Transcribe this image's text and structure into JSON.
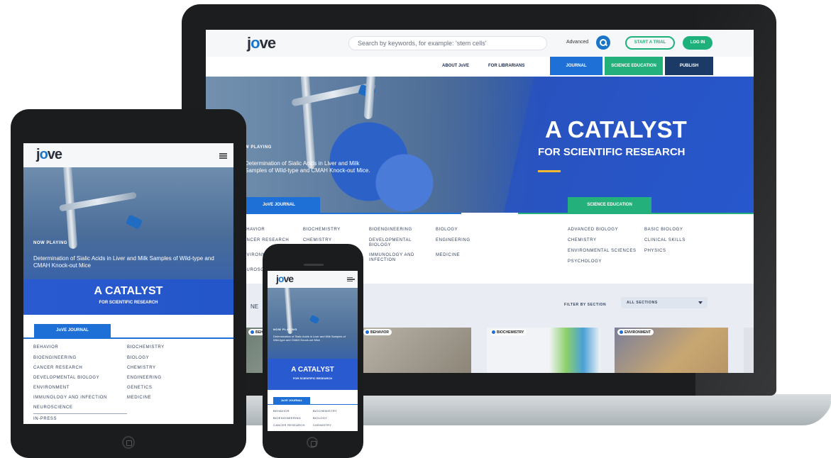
{
  "brand": {
    "logo_prefix": "j",
    "logo_o": "o",
    "logo_suffix": "ve",
    "primary_color": "#1e70d6",
    "green_color": "#23b07a",
    "navy_color": "#1b2a4a"
  },
  "laptop": {
    "search_placeholder": "Search by keywords, for example: 'stem cells'",
    "advanced_label": "Advanced",
    "start_trial_label": "START A TRIAL",
    "login_label": "LOG IN",
    "nav_links": [
      "ABOUT JoVE",
      "FOR LIBRARIANS"
    ],
    "nav_tabs": [
      "JOURNAL",
      "SCIENCE EDUCATION",
      "PUBLISH"
    ],
    "now_playing": "W PLAYING",
    "now_playing_title": "Determination of Sialic Acids in Liver and Milk Samples of Wild-type and CMAH Knock-out Mice.",
    "catalyst_title": "A CATALYST",
    "catalyst_subtitle": "FOR SCIENTIFIC RESEARCH",
    "tab_journal": "JoVE JOURNAL",
    "tab_science_education": "SCIENCE EDUCATION",
    "journal_categories": [
      "BEHAVIOR",
      "BIOCHEMISTRY",
      "BIOENGINEERING",
      "BIOLOGY",
      "CANCER RESEARCH",
      "CHEMISTRY",
      "DEVELOPMENTAL BIOLOGY",
      "ENGINEERING",
      "ENVIRONMENT",
      "IMMUNOLOGY AND INFECTION",
      "MEDICINE",
      "NEUROSCIENCE"
    ],
    "education_categories": [
      "ADVANCED BIOLOGY",
      "BASIC BIOLOGY",
      "CHEMISTRY",
      "CLINICAL SKILLS",
      "ENVIRONMENTAL SCIENCES",
      "PHYSICS",
      "PSYCHOLOGY"
    ],
    "new_label": "NE",
    "filter_label": "FILTER BY SECTION",
    "filter_value": "ALL SECTIONS",
    "cards": [
      "BEHAVIOR",
      "BEHAVIOR",
      "BIOCHEMISTRY",
      "ENVIRONMENT"
    ]
  },
  "tablet": {
    "now_playing": "NOW PLAYING",
    "now_playing_title": "Determination of Sialic Acids in Liver and Milk Samples of Wild-type and CMAH Knock-out Mice",
    "catalyst_title": "A CATALYST",
    "catalyst_subtitle": "FOR SCIENTIFIC RESEARCH",
    "tab_journal": "JoVE JOURNAL",
    "left_categories": [
      "BEHAVIOR",
      "BIOENGINEERING",
      "CANCER RESEARCH",
      "DEVELOPMENTAL BIOLOGY",
      "ENVIRONMENT",
      "IMMUNOLOGY AND INFECTION",
      "NEUROSCIENCE",
      "IN-PRESS"
    ],
    "right_categories": [
      "BIOCHEMISTRY",
      "BIOLOGY",
      "CHEMISTRY",
      "ENGINEERING",
      "GENETICS",
      "MEDICINE"
    ]
  },
  "phone": {
    "now_playing": "NOW PLAYING",
    "now_playing_title": "Determination of Sialic Acids in Liver and Milk Samples of Wild-type and CMAH Knock-out Mice",
    "catalyst_title": "A CATALYST",
    "catalyst_subtitle": "FOR SCIENTIFIC RESEARCH",
    "tab_journal": "JoVE JOURNAL",
    "categories": [
      "BEHAVIOR",
      "BIOCHEMISTRY",
      "BIOENGINEERING",
      "BIOLOGY",
      "CANCER RESEARCH",
      "CHEMISTRY"
    ]
  }
}
